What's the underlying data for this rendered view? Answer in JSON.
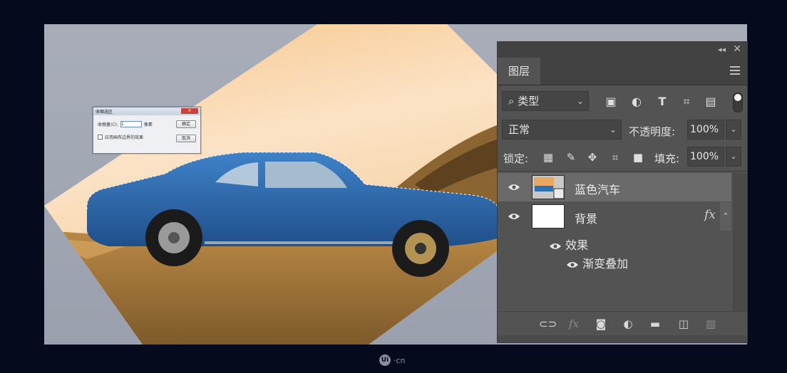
{
  "dialog": {
    "title": "收缩选区",
    "close_label": "✕",
    "amount_label": "收缩量(C):",
    "amount_value": "1",
    "unit": "像素",
    "apply_canvas_label": "应用画布边界的效果",
    "ok_label": "确定",
    "cancel_label": "取消"
  },
  "panel": {
    "collapse_glyph": "◂◂",
    "close_glyph": "✕",
    "tab_label": "图层",
    "filter": {
      "selected": "类型"
    },
    "blend_mode": "正常",
    "opacity_label": "不透明度:",
    "opacity_value": "100%",
    "lock_label": "锁定:",
    "fill_label": "填充:",
    "fill_value": "100%",
    "layers": [
      {
        "name": "蓝色汽车",
        "selected": true
      },
      {
        "name": "背景",
        "selected": false,
        "fx_label": "fx"
      }
    ],
    "effects_label": "效果",
    "effect_item": "渐变叠加",
    "bottom_icons": [
      "link-icon",
      "fx-icon",
      "mask-icon",
      "adjustment-icon",
      "folder-icon",
      "new-layer-icon",
      "trash-icon"
    ],
    "bottom_fx_label": "fx"
  },
  "colors": {
    "panel_bg": "#535353",
    "canvas_bg": "#9aa0ad",
    "car_blue": "#2f6fb5",
    "photo_orange": "#e8a65c"
  },
  "watermark": {
    "logo": "Ui",
    "text": "·cn"
  }
}
